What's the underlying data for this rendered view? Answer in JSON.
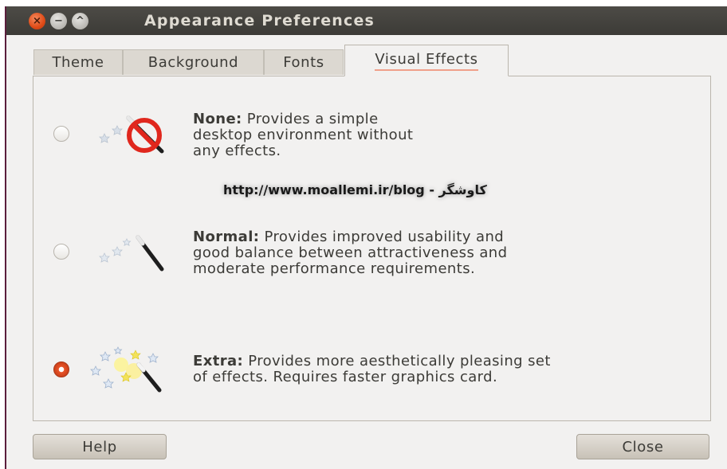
{
  "window": {
    "title": "Appearance Preferences",
    "controls": {
      "close": "×",
      "minimize": "−",
      "maximize": "^"
    }
  },
  "tabs": [
    {
      "label": "Theme",
      "active": false
    },
    {
      "label": "Background",
      "active": false
    },
    {
      "label": "Fonts",
      "active": false
    },
    {
      "label": "Visual Effects",
      "active": true
    }
  ],
  "options": [
    {
      "key": "none",
      "name": "None:",
      "lines": [
        "Provides a simple",
        "desktop environment without",
        "any effects."
      ],
      "selected": false,
      "icon": "magic-wand-disabled-icon"
    },
    {
      "key": "normal",
      "name": "Normal:",
      "lines": [
        "Provides improved usability and",
        "good balance between attractiveness and",
        "moderate performance requirements."
      ],
      "selected": false,
      "icon": "magic-wand-icon"
    },
    {
      "key": "extra",
      "name": "Extra:",
      "lines": [
        "Provides more aesthetically pleasing set",
        "of effects. Requires faster graphics card."
      ],
      "selected": true,
      "icon": "magic-wand-sparkles-icon"
    }
  ],
  "watermark": "http://www.moallemi.ir/blog - کاوشگر",
  "buttons": {
    "help": "Help",
    "close": "Close"
  },
  "colors": {
    "accent": "#e8552a",
    "titlebar": "#3c3b37",
    "background": "#f2f1f0"
  }
}
